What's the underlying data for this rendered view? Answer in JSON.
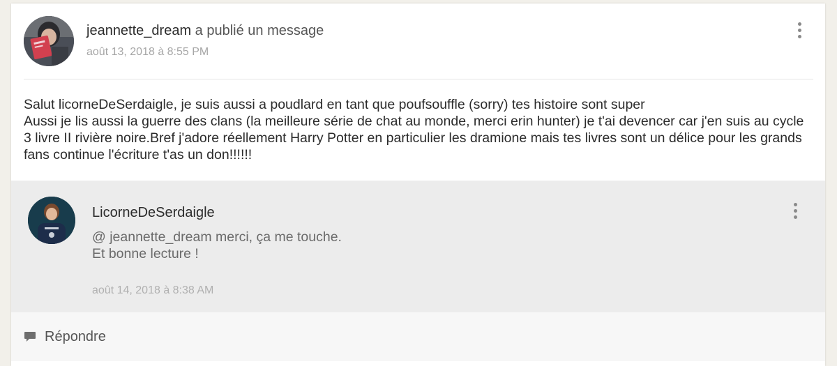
{
  "post": {
    "author": "jeannette_dream",
    "action": " a publié un message",
    "date": "août 13, 2018 à 8:55 PM",
    "body": "Salut licorneDeSerdaigle, je suis aussi a poudlard en tant que poufsouffle (sorry) tes histoire sont super\nAussi je lis aussi la guerre des clans (la meilleure série de chat au monde, merci erin hunter) je t'ai devencer car j'en suis au cycle 3 livre II rivière noire.Bref j'adore réellement Harry Potter en particulier les dramione mais tes livres sont un délice pour les grands fans continue l'écriture t'as un don!!!!!!"
  },
  "reply": {
    "author": "LicorneDeSerdaigle",
    "text": "@ jeannette_dream merci, ça me touche.\nEt bonne lecture !",
    "date": "août 14, 2018 à 8:38 AM"
  },
  "actions": {
    "reply_label": "Répondre"
  },
  "icons": {
    "menu": "more-vertical-icon",
    "comment": "comment-bubble-icon"
  },
  "colors": {
    "reply_background": "#ececec",
    "page_background": "#f2f0ea",
    "muted_text": "#a6a6a6"
  }
}
